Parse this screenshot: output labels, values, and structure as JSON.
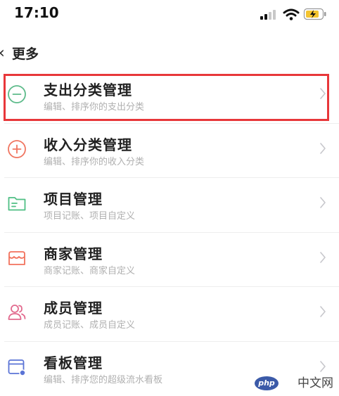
{
  "status_bar": {
    "time": "17:10"
  },
  "nav": {
    "title": "更多"
  },
  "items": [
    {
      "title": "支出分类管理",
      "subtitle": "编辑、排序你的支出分类",
      "icon": "minus-circle-icon",
      "color": "#5dbb8a"
    },
    {
      "title": "收入分类管理",
      "subtitle": "编辑、排序你的收入分类",
      "icon": "plus-circle-icon",
      "color": "#f07560"
    },
    {
      "title": "项目管理",
      "subtitle": "项目记账、项目自定义",
      "icon": "folder-icon",
      "color": "#4fbf84"
    },
    {
      "title": "商家管理",
      "subtitle": "商家记账、商家自定义",
      "icon": "store-icon",
      "color": "#f2725d"
    },
    {
      "title": "成员管理",
      "subtitle": "成员记账、成员自定义",
      "icon": "members-icon",
      "color": "#e26a8e"
    },
    {
      "title": "看板管理",
      "subtitle": "编辑、排序您的超级流水看板",
      "icon": "board-icon",
      "color": "#5b74d6"
    }
  ],
  "watermark": {
    "logo": "php",
    "text": "中文网"
  },
  "colors": {
    "highlight": "#e8373a",
    "subtitle": "#b0b0b0",
    "chevron": "#c7c7cc"
  }
}
